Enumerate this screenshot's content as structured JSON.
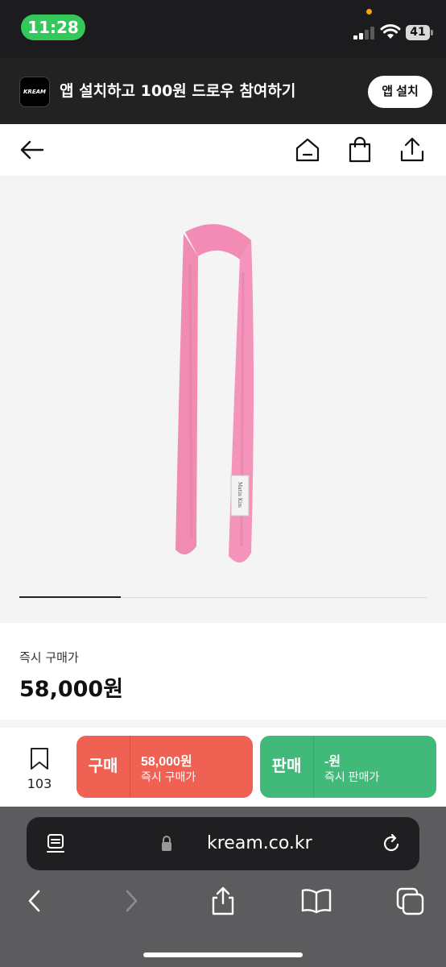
{
  "status_bar": {
    "time": "11:28",
    "battery": "41",
    "colors": {
      "time_pill": "#34c759",
      "privacy_dot": "#ff9f0a"
    }
  },
  "app_banner": {
    "logo": "KREAM",
    "text": "앱 설치하고 100원 드로우 참여하기",
    "install_label": "앱 설치"
  },
  "header": {
    "icons": [
      "back-arrow-icon",
      "home-icon",
      "shopping-bag-icon",
      "share-icon"
    ]
  },
  "product": {
    "image": "pink-knit-scarf",
    "label_brand": "Matin Kim",
    "image_indicator_position": 0.2
  },
  "price": {
    "label": "즉시 구매가",
    "value": "58,000원"
  },
  "action_bar": {
    "wishlist_count": "103",
    "buy": {
      "label": "구매",
      "price": "58,000원",
      "sub": "즉시 구매가",
      "color": "#ef6253"
    },
    "sell": {
      "label": "판매",
      "price": "-원",
      "sub": "즉시 판매가",
      "color": "#41b979"
    }
  },
  "browser": {
    "url": "kream.co.kr",
    "icons": [
      "reader-icon",
      "lock-icon",
      "reload-icon",
      "back-icon",
      "forward-icon",
      "share-icon",
      "bookmarks-icon",
      "tabs-icon"
    ]
  }
}
